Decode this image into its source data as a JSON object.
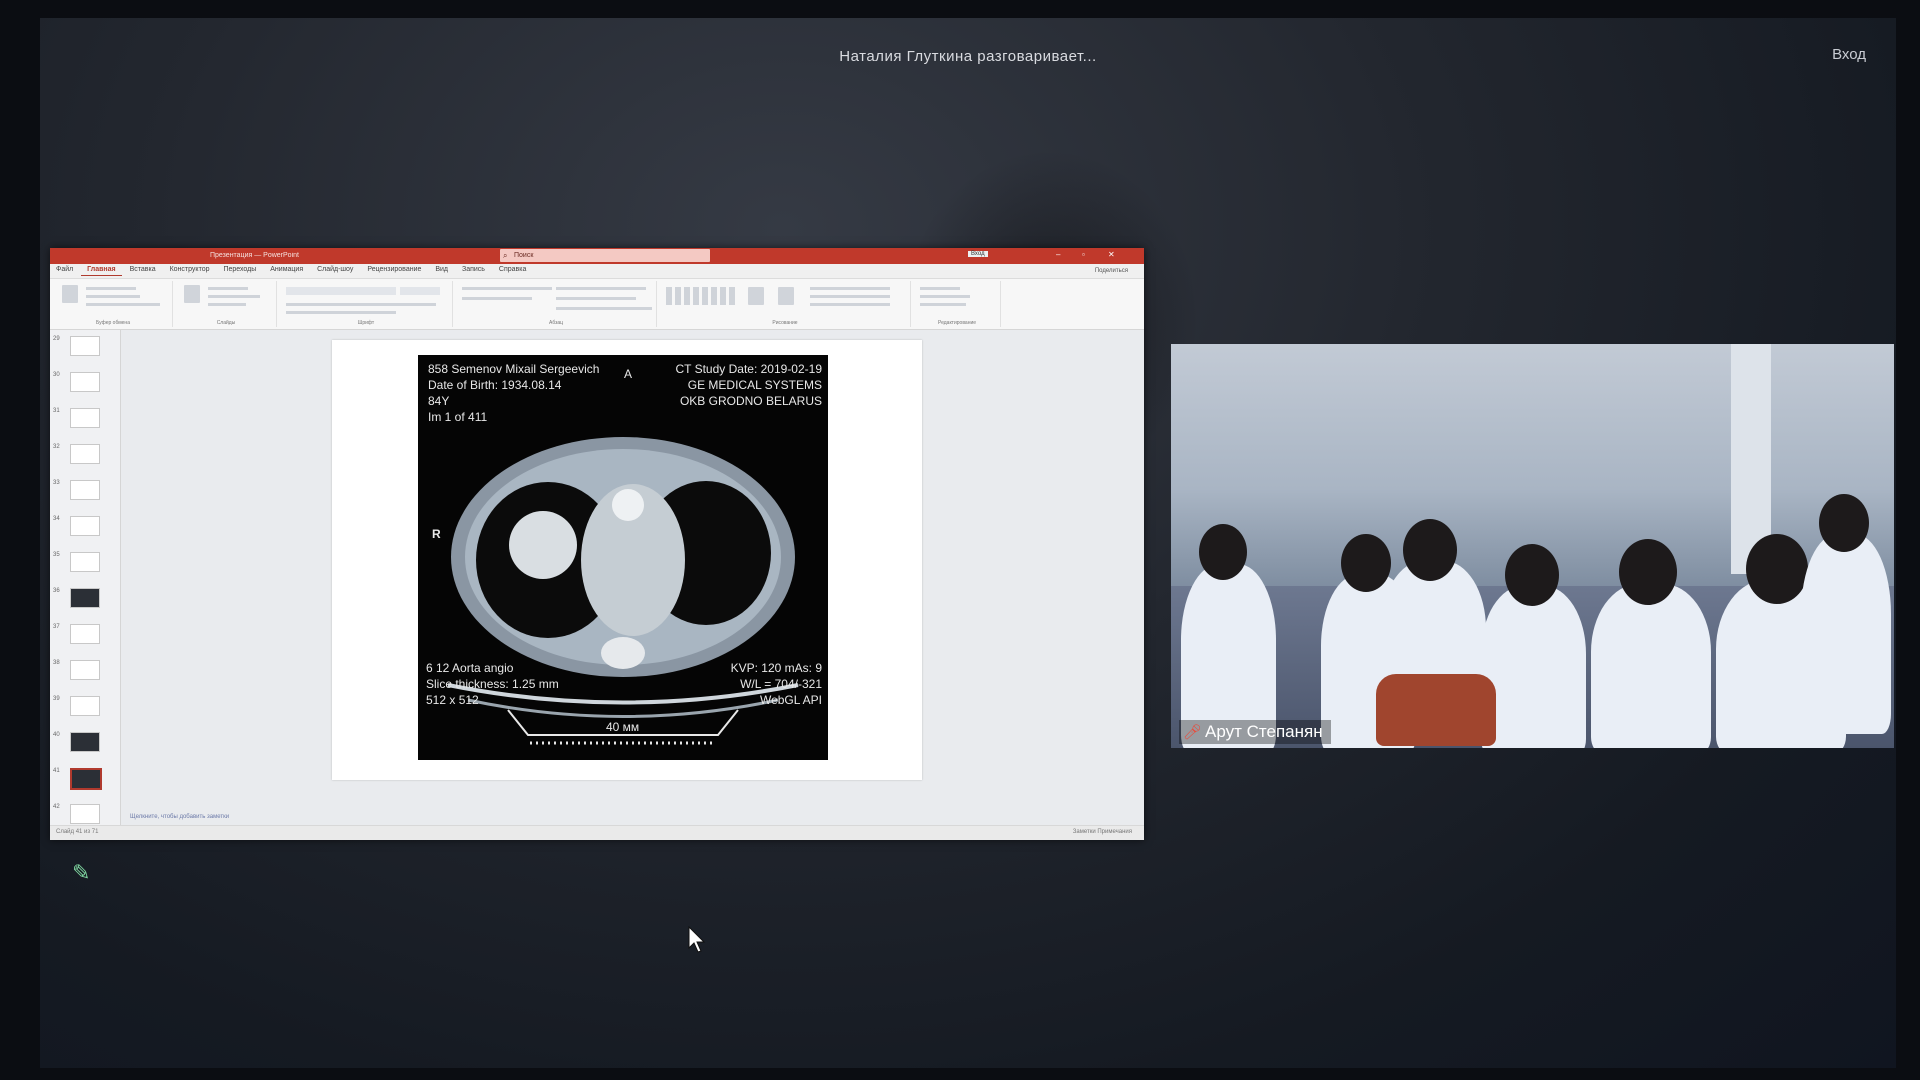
{
  "meeting": {
    "speaker_status": "Наталия Глуткина разговаривает...",
    "login_label": "Вход"
  },
  "powerpoint": {
    "title_text": "Презентация — PowerPoint",
    "search_placeholder": "Поиск",
    "signin_label": "Вход",
    "share_label": "Поделиться",
    "tabs": [
      "Файл",
      "Главная",
      "Вставка",
      "Конструктор",
      "Переходы",
      "Анимация",
      "Слайд-шоу",
      "Рецензирование",
      "Вид",
      "Запись",
      "Справка"
    ],
    "active_tab": "Главная",
    "ribbon_groups": [
      "Буфер обмена",
      "Слайды",
      "Шрифт",
      "Абзац",
      "Рисование",
      "Редактирование"
    ],
    "slide_numbers": [
      "29",
      "30",
      "31",
      "32",
      "33",
      "34",
      "35",
      "36",
      "37",
      "38",
      "39",
      "40",
      "41",
      "42"
    ],
    "notes_hint": "Щелкните, чтобы добавить заметки",
    "status_left": "Слайд 41 из 71",
    "status_right": "Заметки   Примечания"
  },
  "ct_scan": {
    "patient_name": "858 Semenov Mixail Sergeevich",
    "dob": "Date of Birth: 1934.08.14",
    "age": "84Y",
    "image_index": "Im 1 of 411",
    "study_date": "CT Study Date: 2019-02-19",
    "manufacturer": "GE MEDICAL SYSTEMS",
    "hospital": "OKB GRODNO BELARUS",
    "series": "6 12 Aorta angio",
    "slice_thickness": "Slice thickness: 1.25 mm",
    "matrix": "512 x 512",
    "kvp": "KVP: 120 mAs: 9",
    "window": "W/L = 704/-321",
    "renderer": "WebGL API",
    "orient_anterior": "A",
    "orient_right": "R",
    "scale_label": "40 мм"
  },
  "video": {
    "participant_name": "Арут Степанян"
  },
  "icons": {
    "mic": "microphone-muted-icon",
    "pen": "pen-icon",
    "cursor": "cursor-icon"
  },
  "colors": {
    "ppt_accent": "#c0392b",
    "pen": "#7fd6a0",
    "mic_muted": "#e74c3c"
  }
}
